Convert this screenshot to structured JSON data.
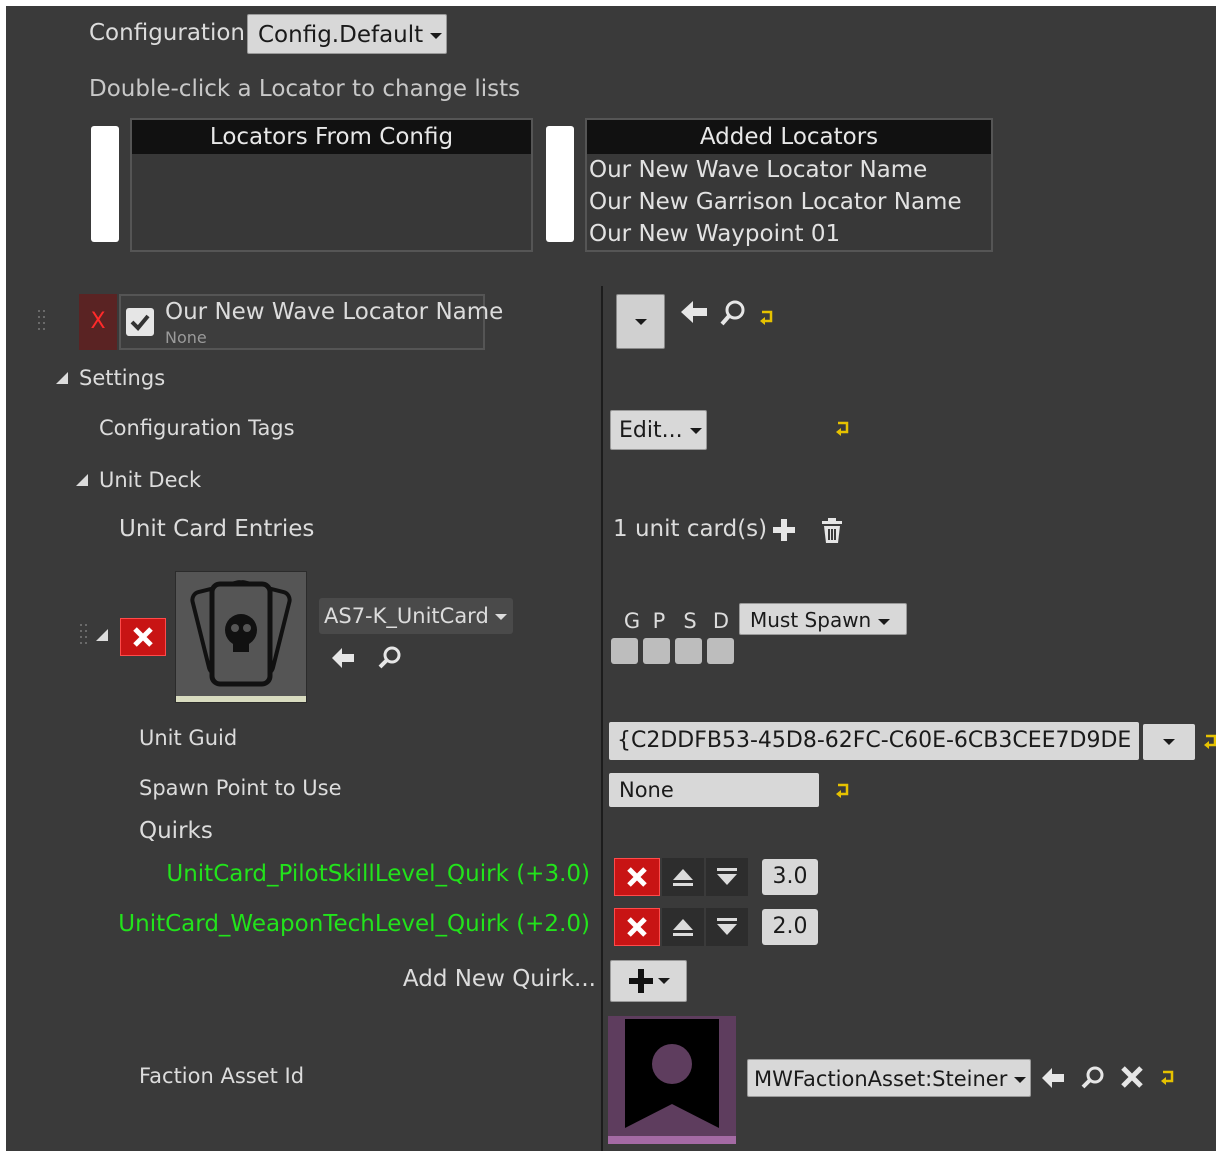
{
  "header": {
    "config_label": "Configuration:",
    "config_value": "Config.Default",
    "hint": "Double-click a Locator to change lists"
  },
  "lists": {
    "from_config_title": "Locators From Config",
    "from_config_items": [],
    "added_title": "Added Locators",
    "added_items": [
      "Our New Wave Locator Name",
      "Our New Garrison Locator Name",
      "Our New Waypoint 01"
    ]
  },
  "locator": {
    "remove_glyph": "X",
    "name": "Our New Wave Locator Name",
    "subtitle": "None",
    "checked": true
  },
  "settings": {
    "label": "Settings",
    "config_tags_label": "Configuration Tags",
    "edit_button": "Edit...",
    "unit_deck_label": "Unit Deck",
    "unit_card_entries_label": "Unit Card Entries",
    "unit_card_count": "1 unit card(s)"
  },
  "unit_card": {
    "asset_name": "AS7-K_UnitCard",
    "flags": [
      "G",
      "P",
      "S",
      "D"
    ],
    "spawn_mode": "Must Spawn",
    "unit_guid_label": "Unit Guid",
    "unit_guid_value": "{C2DDFB53-45D8-62FC-C60E-6CB3CEE7D9DE",
    "spawn_point_label": "Spawn Point to Use",
    "spawn_point_value": "None",
    "quirks_label": "Quirks",
    "quirks": [
      {
        "name": "UnitCard_PilotSkillLevel_Quirk (+3.0)",
        "value": "3.0"
      },
      {
        "name": "UnitCard_WeaponTechLevel_Quirk (+2.0)",
        "value": "2.0"
      }
    ],
    "add_quirk_label": "Add New Quirk...",
    "faction_label": "Faction Asset Id",
    "faction_value": "MWFactionAsset:Steiner"
  },
  "colors": {
    "background": "#3a3a3a",
    "quirk_text": "#22e31b",
    "reset_arrow": "#e6c200",
    "delete_red": "#c81414"
  }
}
